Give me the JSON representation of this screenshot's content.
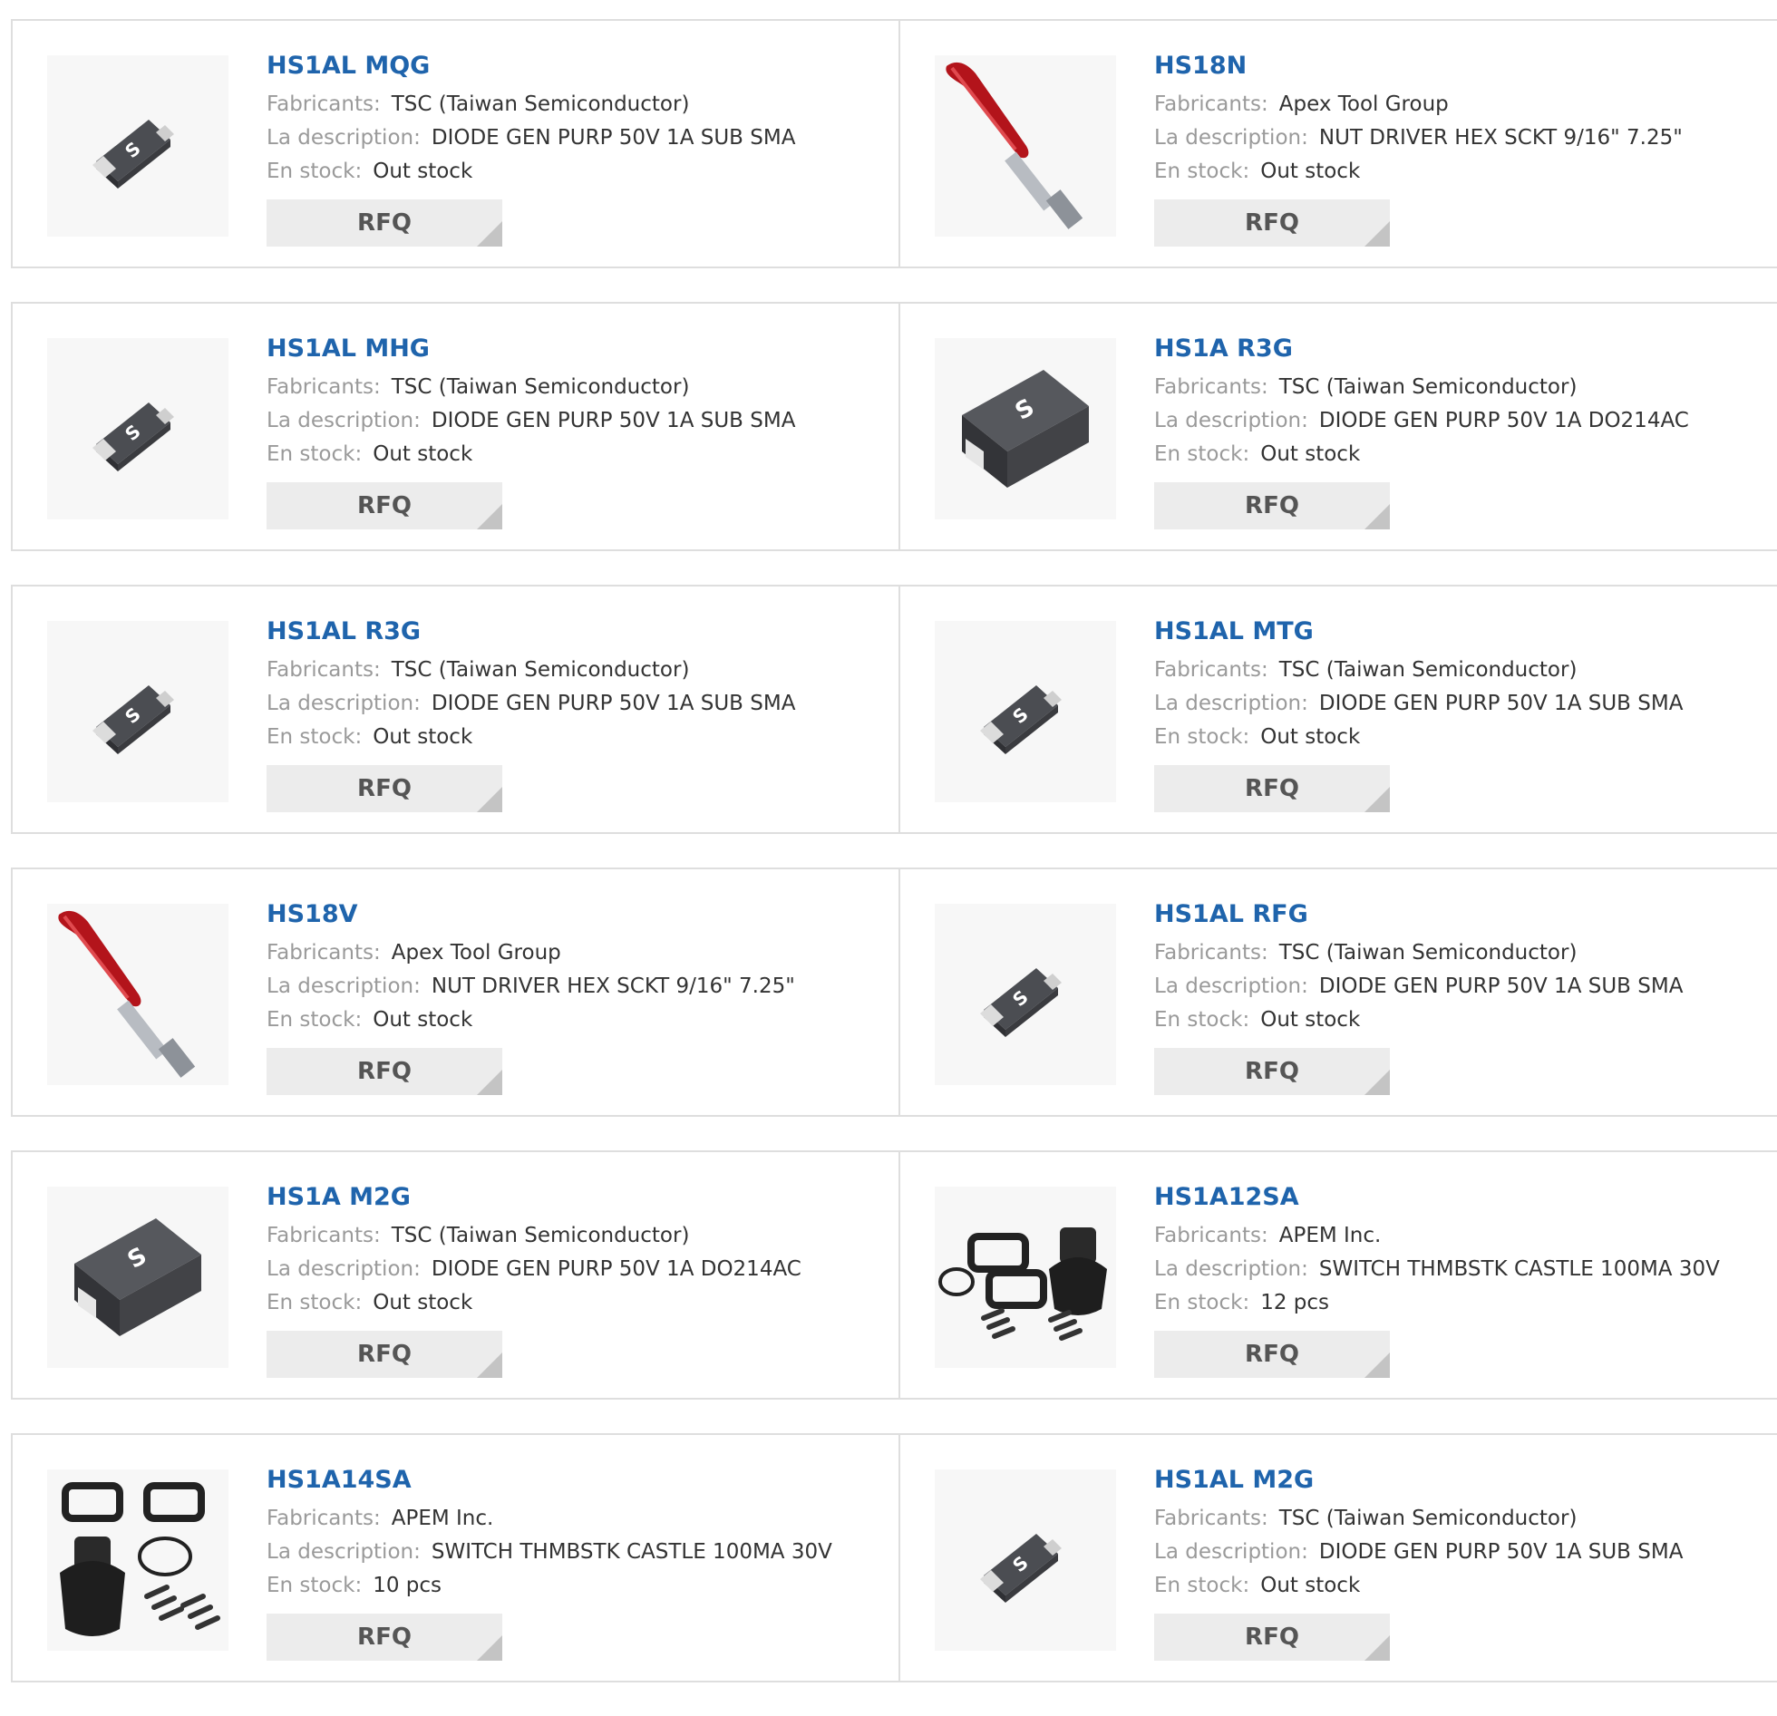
{
  "labels": {
    "manufacturer": "Fabricants:",
    "description": "La description:",
    "stock": "En stock:",
    "rfq": "RFQ"
  },
  "colors": {
    "link": "#1f64ac",
    "label": "#9a9a9a",
    "button_bg": "#ececec",
    "border": "#dedede"
  },
  "products": [
    {
      "part": "HS1AL MQG",
      "manufacturer": "TSC (Taiwan Semiconductor)",
      "description": "DIODE GEN PURP 50V 1A SUB SMA",
      "stock": "Out stock",
      "image": "diode-sub-sma"
    },
    {
      "part": "HS18N",
      "manufacturer": "Apex Tool Group",
      "description": "NUT DRIVER HEX SCKT 9/16\" 7.25\"",
      "stock": "Out stock",
      "image": "nut-driver"
    },
    {
      "part": "HS1AL MHG",
      "manufacturer": "TSC (Taiwan Semiconductor)",
      "description": "DIODE GEN PURP 50V 1A SUB SMA",
      "stock": "Out stock",
      "image": "diode-sub-sma"
    },
    {
      "part": "HS1A R3G",
      "manufacturer": "TSC (Taiwan Semiconductor)",
      "description": "DIODE GEN PURP 50V 1A DO214AC",
      "stock": "Out stock",
      "image": "diode-do214ac"
    },
    {
      "part": "HS1AL R3G",
      "manufacturer": "TSC (Taiwan Semiconductor)",
      "description": "DIODE GEN PURP 50V 1A SUB SMA",
      "stock": "Out stock",
      "image": "diode-sub-sma"
    },
    {
      "part": "HS1AL MTG",
      "manufacturer": "TSC (Taiwan Semiconductor)",
      "description": "DIODE GEN PURP 50V 1A SUB SMA",
      "stock": "Out stock",
      "image": "diode-sub-sma"
    },
    {
      "part": "HS18V",
      "manufacturer": "Apex Tool Group",
      "description": "NUT DRIVER HEX SCKT 9/16\" 7.25\"",
      "stock": "Out stock",
      "image": "nut-driver"
    },
    {
      "part": "HS1AL RFG",
      "manufacturer": "TSC (Taiwan Semiconductor)",
      "description": "DIODE GEN PURP 50V 1A SUB SMA",
      "stock": "Out stock",
      "image": "diode-sub-sma"
    },
    {
      "part": "HS1A M2G",
      "manufacturer": "TSC (Taiwan Semiconductor)",
      "description": "DIODE GEN PURP 50V 1A DO214AC",
      "stock": "Out stock",
      "image": "diode-do214ac"
    },
    {
      "part": "HS1A12SA",
      "manufacturer": "APEM Inc.",
      "description": "SWITCH THMBSTK CASTLE 100MA 30V",
      "stock": "12 pcs",
      "image": "thumbstick-kit"
    },
    {
      "part": "HS1A14SA",
      "manufacturer": "APEM Inc.",
      "description": "SWITCH THMBSTK CASTLE 100MA 30V",
      "stock": "10 pcs",
      "image": "thumbstick-kit-2"
    },
    {
      "part": "HS1AL M2G",
      "manufacturer": "TSC (Taiwan Semiconductor)",
      "description": "DIODE GEN PURP 50V 1A SUB SMA",
      "stock": "Out stock",
      "image": "diode-sub-sma"
    }
  ]
}
